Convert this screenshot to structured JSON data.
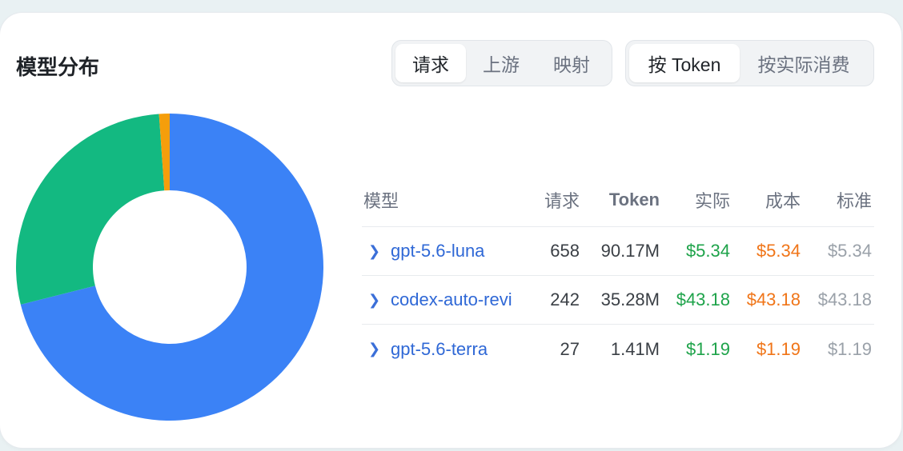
{
  "title": "模型分布",
  "segment_view": {
    "options": [
      "请求",
      "上游",
      "映射"
    ],
    "selected": "请求"
  },
  "segment_metric": {
    "options": [
      "按 Token",
      "按实际消费"
    ],
    "selected": "按 Token"
  },
  "table": {
    "headers": {
      "model": "模型",
      "requests": "请求",
      "token": "Token",
      "actual": "实际",
      "cost": "成本",
      "standard": "标准"
    },
    "rows": [
      {
        "model": "gpt-5.6-luna",
        "requests": "658",
        "token": "90.17M",
        "actual": "$5.34",
        "cost": "$5.34",
        "standard": "$5.34"
      },
      {
        "model": "codex-auto-revi",
        "requests": "242",
        "token": "35.28M",
        "actual": "$43.18",
        "cost": "$43.18",
        "standard": "$43.18"
      },
      {
        "model": "gpt-5.6-terra",
        "requests": "27",
        "token": "1.41M",
        "actual": "$1.19",
        "cost": "$1.19",
        "standard": "$1.19"
      }
    ]
  },
  "chart_data": {
    "type": "pie",
    "donut": true,
    "categories": [
      "gpt-5.6-luna",
      "codex-auto-revi",
      "gpt-5.6-terra"
    ],
    "values": [
      90.17,
      35.28,
      1.41
    ],
    "colors": [
      "#3b82f6",
      "#13b981",
      "#f59e0b"
    ]
  },
  "colors": {
    "link": "#2f68d6",
    "actual": "#1ea34a",
    "cost": "#f07518",
    "standard": "#9aa1a9"
  }
}
